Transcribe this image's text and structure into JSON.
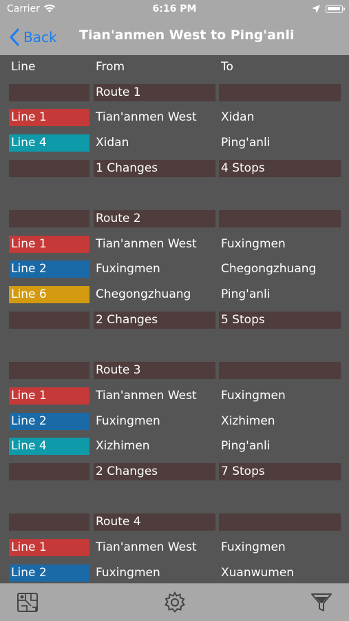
{
  "status_bar": {
    "carrier": "Carrier",
    "time": "6:16 PM"
  },
  "nav": {
    "back_label": "Back",
    "title": "Tian'anmen West to Ping'anli"
  },
  "headers": {
    "line": "Line",
    "from": "From",
    "to": "To"
  },
  "line_colors": {
    "Line 1": "#c53a38",
    "Line 2": "#1b6aa8",
    "Line 4": "#0f9aaa",
    "Line 6": "#d39a10"
  },
  "routes": [
    {
      "title": "Route 1",
      "legs": [
        {
          "line": "Line 1",
          "from": "Tian'anmen West",
          "to": "Xidan"
        },
        {
          "line": "Line 4",
          "from": "Xidan",
          "to": "Ping'anli"
        }
      ],
      "changes": "1 Changes",
      "stops": "4 Stops"
    },
    {
      "title": "Route 2",
      "legs": [
        {
          "line": "Line 1",
          "from": "Tian'anmen West",
          "to": "Fuxingmen"
        },
        {
          "line": "Line 2",
          "from": "Fuxingmen",
          "to": "Chegongzhuang"
        },
        {
          "line": "Line 6",
          "from": "Chegongzhuang",
          "to": "Ping'anli"
        }
      ],
      "changes": "2 Changes",
      "stops": "5 Stops"
    },
    {
      "title": "Route 3",
      "legs": [
        {
          "line": "Line 1",
          "from": "Tian'anmen West",
          "to": "Fuxingmen"
        },
        {
          "line": "Line 2",
          "from": "Fuxingmen",
          "to": "Xizhimen"
        },
        {
          "line": "Line 4",
          "from": "Xizhimen",
          "to": "Ping'anli"
        }
      ],
      "changes": "2 Changes",
      "stops": "7 Stops"
    },
    {
      "title": "Route 4",
      "legs": [
        {
          "line": "Line 1",
          "from": "Tian'anmen West",
          "to": "Fuxingmen"
        },
        {
          "line": "Line 2",
          "from": "Fuxingmen",
          "to": "Xuanwumen"
        }
      ],
      "changes": "",
      "stops": ""
    }
  ],
  "tab_bar": {
    "icons": [
      "map-icon",
      "gear-icon",
      "filter-icon"
    ]
  }
}
